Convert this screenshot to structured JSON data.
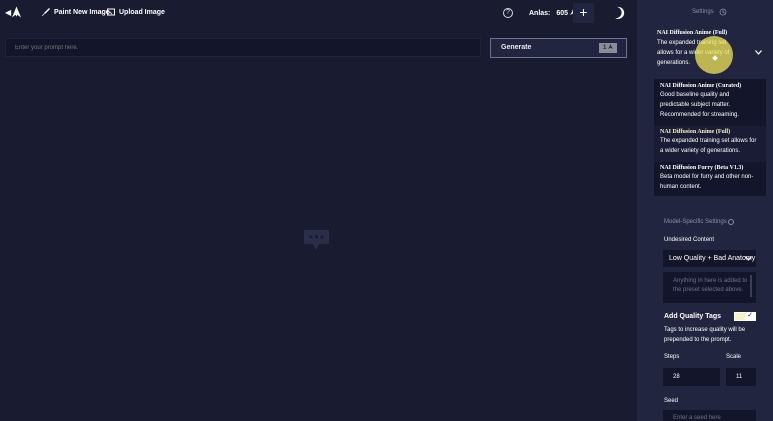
{
  "topbar": {
    "paint_label": "Paint New Image",
    "upload_label": "Upload Image",
    "help_glyph": "?",
    "anlas_label": "Anlas:",
    "anlas_value": "605",
    "plus_glyph": "+"
  },
  "prompt": {
    "placeholder": "Enter your prompt here.",
    "generate_label": "Generate",
    "generate_cost": "1"
  },
  "sidebar": {
    "title": "Settings",
    "model_select": {
      "selected_name": "NAI Diffusion Anime (Full)",
      "selected_desc": "The expanded training set allows for a wider variety of generations."
    },
    "model_options": [
      {
        "name": "NAI Diffusion Anime (Curated)",
        "desc": "Good baseline quality and predictable subject matter. Recommended for streaming."
      },
      {
        "name": "NAI Diffusion Anime (Full)",
        "desc": "The expanded training set allows for a wider variety of generations."
      },
      {
        "name": "NAI Diffusion Furry (Beta V1.3)",
        "desc": "Beta model for furry and other non-human content."
      }
    ],
    "model_settings_label": "Model-Specific Settings",
    "undesired_label": "Undesired Content",
    "undesired_preset": "Low Quality + Bad Anatomy",
    "undesired_placeholder": "Anything in here is added to the preset selected above.",
    "quality_tags_label": "Add Quality Tags",
    "quality_tags_desc": "Tags to increase quality will be prepended to the prompt.",
    "steps_label": "Steps",
    "steps_value": "28",
    "scale_label": "Scale",
    "scale_value": "11",
    "seed_label": "Seed",
    "seed_placeholder": "Enter a seed here"
  },
  "colors": {
    "background": "#191b31",
    "sidebar": "#22253f",
    "input": "#13152b",
    "accent": "#f5f3c2"
  }
}
